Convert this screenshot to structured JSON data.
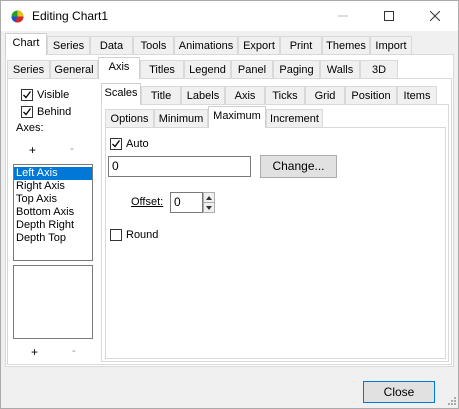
{
  "window": {
    "title": "Editing Chart1"
  },
  "main_tabs": [
    "Chart",
    "Series",
    "Data",
    "Tools",
    "Animations",
    "Export",
    "Print",
    "Themes",
    "Import"
  ],
  "chart_tabs": [
    "Series",
    "General",
    "Axis",
    "Titles",
    "Legend",
    "Panel",
    "Paging",
    "Walls",
    "3D"
  ],
  "axes_panel": {
    "visible_label": "Visible",
    "behind_label": "Behind",
    "axes_label": "Axes:",
    "add_symbol": "+",
    "remove_symbol": "-",
    "axes": [
      "Left Axis",
      "Right Axis",
      "Top Axis",
      "Bottom Axis",
      "Depth Right",
      "Depth Top"
    ],
    "selected_index": 0
  },
  "axis_tabs": [
    "Scales",
    "Title",
    "Labels",
    "Axis",
    "Ticks",
    "Grid",
    "Position",
    "Items"
  ],
  "scale_tabs": [
    "Options",
    "Minimum",
    "Maximum",
    "Increment"
  ],
  "maximum": {
    "auto_label": "Auto",
    "auto_checked": true,
    "value": "0",
    "change_button": "Change...",
    "offset_label": "Offset:",
    "offset_value": "0",
    "round_label": "Round",
    "round_checked": false
  },
  "footer": {
    "close_button": "Close"
  }
}
